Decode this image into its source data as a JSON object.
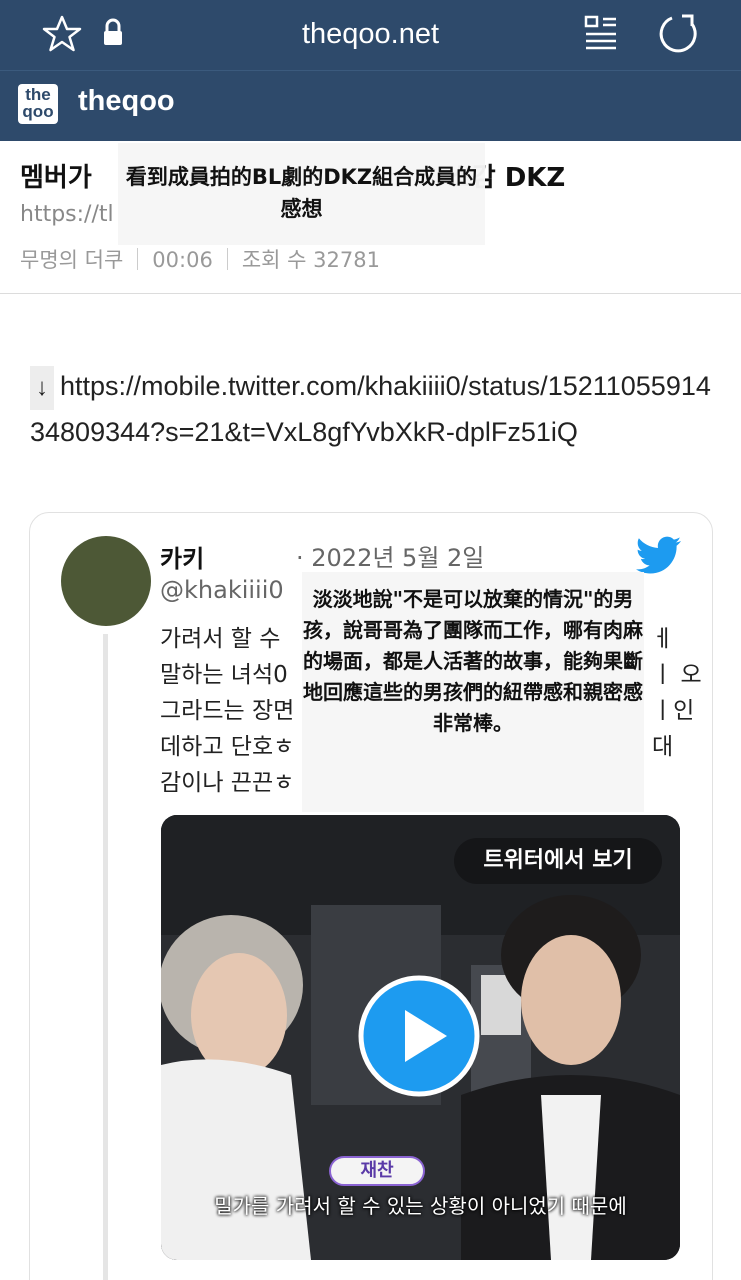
{
  "browser": {
    "url": "theqoo.net",
    "icons": [
      "star-icon",
      "lock-icon",
      "tab-list-icon",
      "reload-icon"
    ]
  },
  "site": {
    "logo_top": "the",
    "logo_bottom": "qoo",
    "name": "theqoo"
  },
  "post": {
    "title_start": "멤버가 ",
    "title_end": "소감 DKZ",
    "url_fragment": "https://tl",
    "author": "무명의 더쿠",
    "time": "00:06",
    "views": "조회 수 32781"
  },
  "title_overlay": "看到成員拍的BL劇的DKZ組合成員的感想",
  "link": {
    "arrow": "↓",
    "url": "https://mobile.twitter.com/khakiiii0/status/1521105591434809344?s=21&t=VxL8gfYvbXkR-dplFz51iQ"
  },
  "tweet": {
    "author": "카키",
    "date": "· 2022년 5월 2일",
    "handle": "@khakiiii0",
    "lines_left": [
      "가려서 할 수",
      "말하는 녀석0",
      "그라드는 장면",
      "데하고 단호ㅎ",
      "감이나 끈끈ㅎ"
    ],
    "lines_right": [
      "ㅔ",
      "ㅣ 오",
      "ㅣ인",
      "대"
    ],
    "overlay": "淡淡地說\"不是可以放棄的情況\"的男孩，說哥哥為了團隊而工作，哪有肉麻的場面，都是人活著的故事，能夠果斷地回應這些的男孩們的紐帶感和親密感非常棒。"
  },
  "video": {
    "view_on_twitter": "트위터에서 보기",
    "speaker": "재찬",
    "subtitle": "밀가를 가려서 할 수 있는 상황이 아니었기 때문에"
  },
  "colors": {
    "header": "#2e4a6b",
    "avatar": "#4d5836",
    "twitter_blue": "#1d9bf0",
    "speaker_border": "#8a63d2"
  }
}
